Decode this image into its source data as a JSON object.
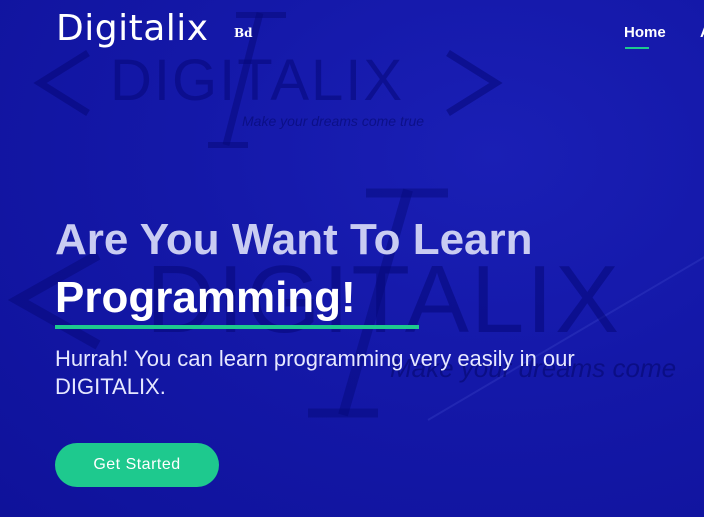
{
  "header": {
    "logo": "Digitalix",
    "logo_badge": "Bd",
    "nav": [
      {
        "label": "Home",
        "active": true
      },
      {
        "label": "A",
        "active": false
      }
    ]
  },
  "watermark": {
    "brand": "DIGITALIX",
    "tagline_top": "Make your dreams come true",
    "tagline_mid": "Make your dreams come"
  },
  "hero": {
    "title": "Are You Want To Learn",
    "highlight": "Programming!",
    "subtitle": "Hurrah! You can learn programming very easily in our DIGITALIX.",
    "cta_label": "Get Started"
  },
  "colors": {
    "background": "#1216a6",
    "accent": "#1ec98e",
    "title_text": "#c9ccf2"
  }
}
